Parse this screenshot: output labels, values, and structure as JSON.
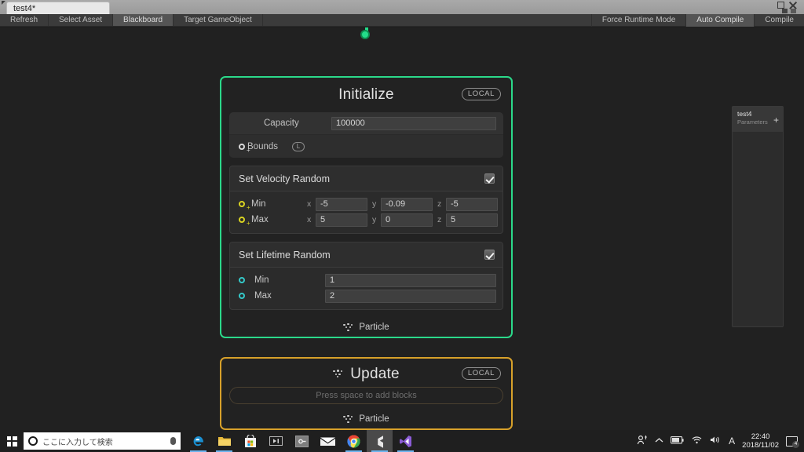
{
  "window": {
    "tab_label": "test4*",
    "controls": {
      "restore": "restore-window",
      "close": "close-window"
    }
  },
  "toolbar": {
    "left_buttons": [
      {
        "label": "Refresh",
        "active": false
      },
      {
        "label": "Select Asset",
        "active": false
      },
      {
        "label": "Blackboard",
        "active": true
      },
      {
        "label": "Target GameObject",
        "active": false
      }
    ],
    "right_buttons": [
      {
        "label": "Force Runtime Mode",
        "active": false
      },
      {
        "label": "Auto Compile",
        "active": true
      },
      {
        "label": "Compile",
        "active": false
      }
    ]
  },
  "graph": {
    "nodes": [
      {
        "title": "Initialize",
        "badge": "LOCAL",
        "accent": "#2bd98a",
        "slots": [
          {
            "label": "Capacity",
            "value": "100000",
            "port": false
          },
          {
            "label": "Bounds",
            "value": "",
            "port": true,
            "badge": "L"
          }
        ],
        "blocks": [
          {
            "title": "Set Velocity Random",
            "enabled": true,
            "rows": [
              {
                "label": "Min",
                "port_color": "yellow",
                "axes": [
                  {
                    "axis": "x",
                    "value": "-5"
                  },
                  {
                    "axis": "y",
                    "value": "-0.09"
                  },
                  {
                    "axis": "z",
                    "value": "-5"
                  }
                ]
              },
              {
                "label": "Max",
                "port_color": "yellow",
                "axes": [
                  {
                    "axis": "x",
                    "value": "5"
                  },
                  {
                    "axis": "y",
                    "value": "0"
                  },
                  {
                    "axis": "z",
                    "value": "5"
                  }
                ]
              }
            ]
          },
          {
            "title": "Set Lifetime Random",
            "enabled": true,
            "rows": [
              {
                "label": "Min",
                "port_color": "cyan",
                "axes": [
                  {
                    "axis": "",
                    "value": "1"
                  }
                ]
              },
              {
                "label": "Max",
                "port_color": "cyan",
                "axes": [
                  {
                    "axis": "",
                    "value": "2"
                  }
                ]
              }
            ]
          }
        ],
        "output_label": "Particle"
      },
      {
        "title": "Update",
        "badge": "LOCAL",
        "accent": "#d8a12a",
        "placeholder": "Press space to add blocks",
        "output_label": "Particle"
      }
    ]
  },
  "blackboard": {
    "title": "test4",
    "subtitle": "Parameters",
    "add_label": "+"
  },
  "taskbar": {
    "search_placeholder": "ここに入力して検索",
    "apps": [
      {
        "name": "edge",
        "glyph": "e",
        "running": true,
        "active": false
      },
      {
        "name": "file-explorer",
        "glyph": "",
        "running": true,
        "active": false
      },
      {
        "name": "microsoft-store",
        "glyph": "",
        "running": false,
        "active": false
      },
      {
        "name": "media-player",
        "glyph": "",
        "running": false,
        "active": false
      },
      {
        "name": "settings",
        "glyph": "",
        "running": false,
        "active": false
      },
      {
        "name": "mail",
        "glyph": "",
        "running": false,
        "active": false
      },
      {
        "name": "chrome",
        "glyph": "",
        "running": true,
        "active": false
      },
      {
        "name": "unity",
        "glyph": "",
        "running": true,
        "active": true
      },
      {
        "name": "visual-studio",
        "glyph": "",
        "running": true,
        "active": false
      }
    ],
    "tray": {
      "ime": "A",
      "time": "22:40",
      "date": "2018/11/02",
      "notification_count": "4"
    }
  }
}
